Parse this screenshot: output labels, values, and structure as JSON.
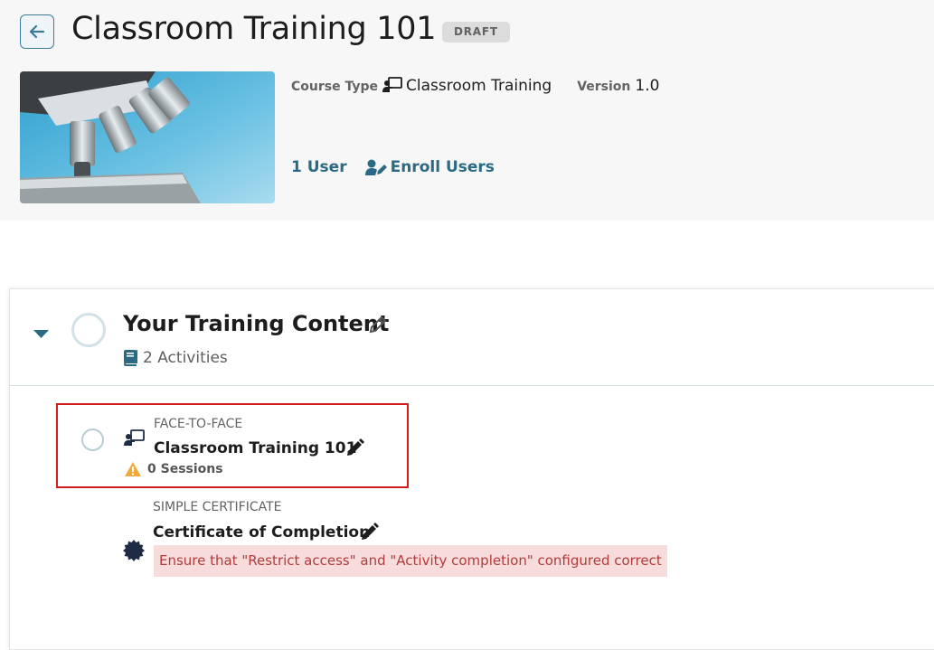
{
  "header": {
    "title": "Classroom Training 101",
    "status_badge": "DRAFT",
    "image_alt": "microscope",
    "course_type_label": "Course Type",
    "course_type_value": "Classroom Training",
    "version_label": "Version",
    "version_value": "1.0",
    "users_link": "1 User",
    "enroll_link": "Enroll Users"
  },
  "section": {
    "title": "Your Training Content",
    "activities_count": "2 Activities"
  },
  "activities": [
    {
      "type": "FACE-TO-FACE",
      "title": "Classroom Training 101",
      "sessions": "0 Sessions"
    },
    {
      "type": "SIMPLE CERTIFICATE",
      "title": "Certificate of Completion",
      "warning": "Ensure that \"Restrict access\" and \"Activity completion\" configured correct"
    }
  ],
  "colors": {
    "accent": "#2b6a85",
    "highlight_border": "#d61d1d",
    "warning_bg": "#f8dcdc",
    "warning_text": "#b23b3b",
    "alert_icon": "#f2a93b"
  }
}
